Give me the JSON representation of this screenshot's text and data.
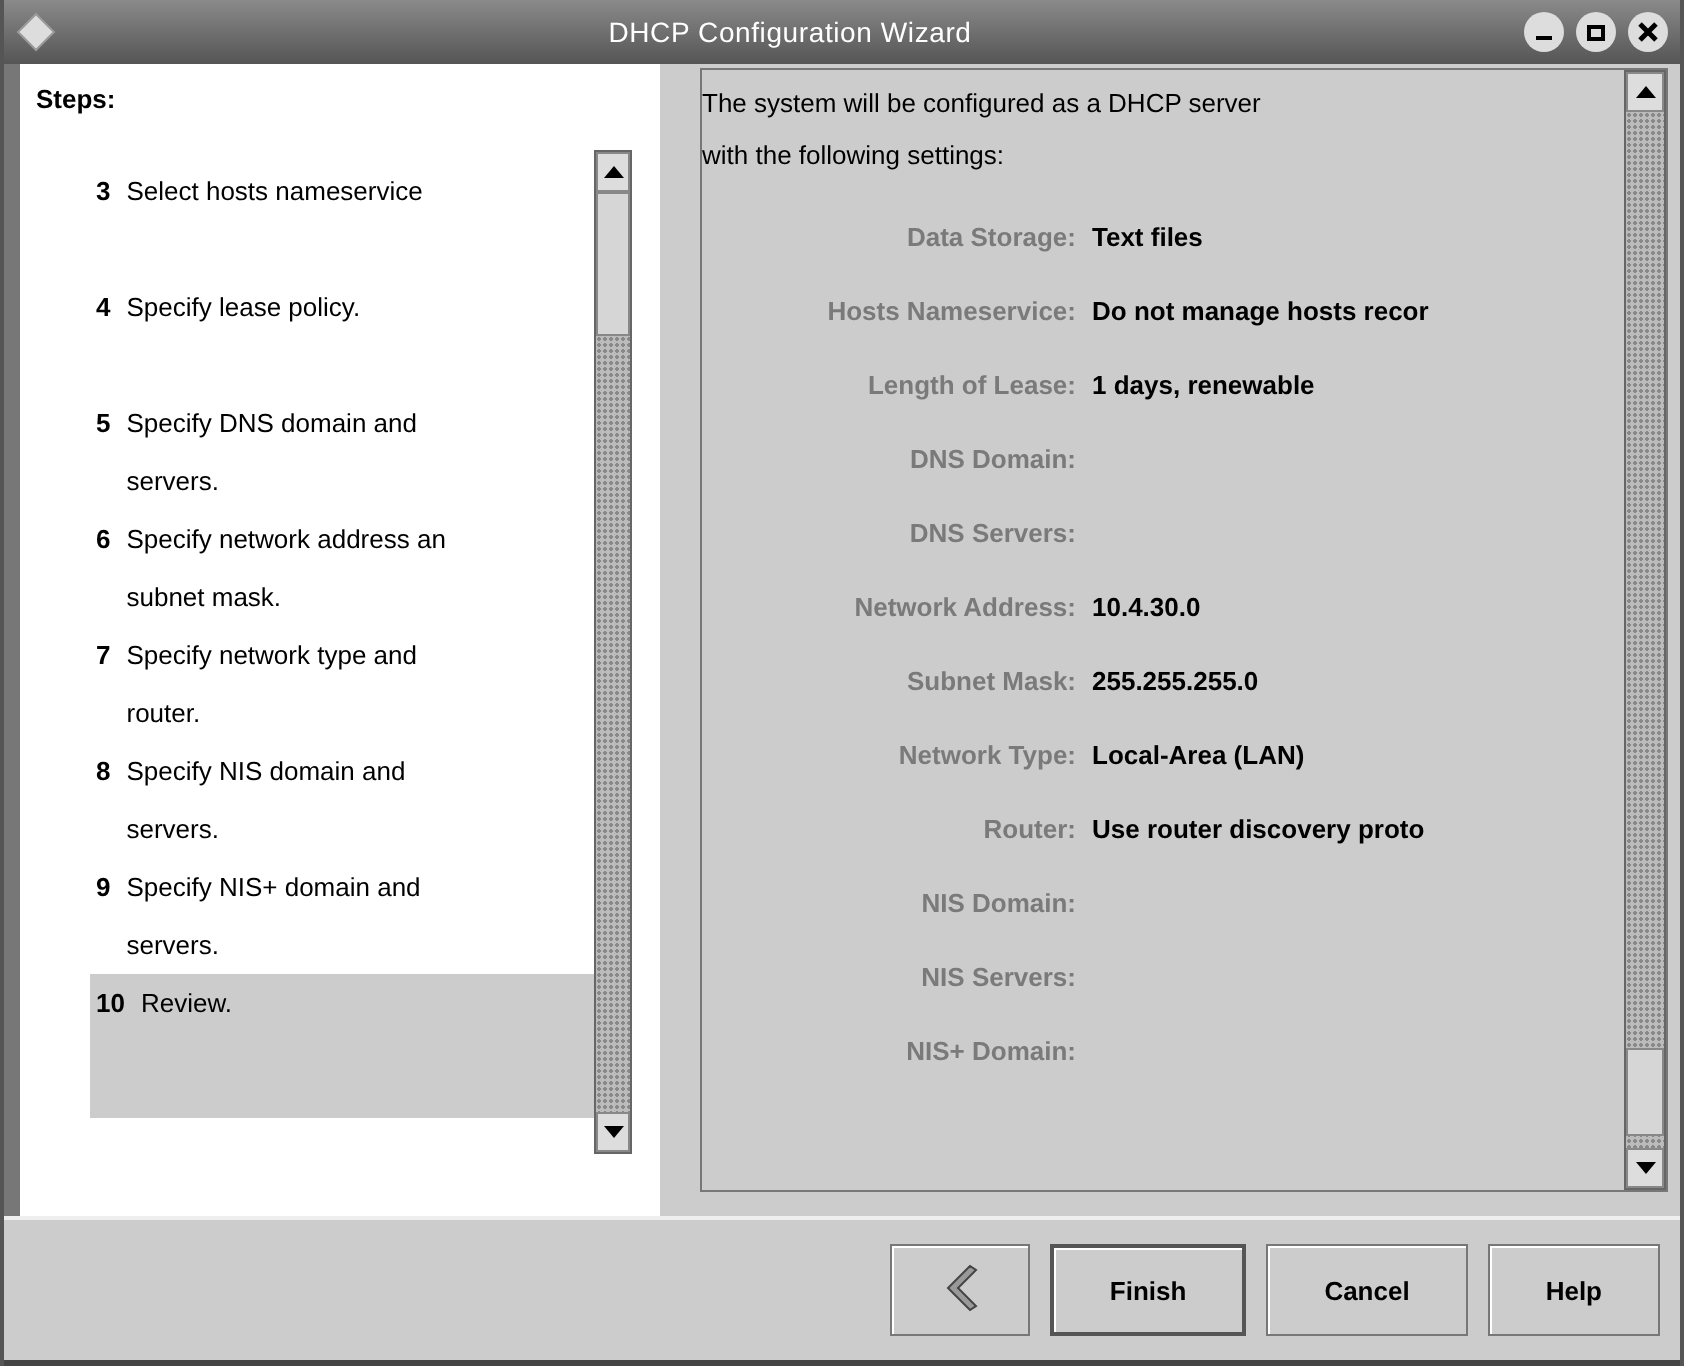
{
  "window": {
    "title": "DHCP Configuration Wizard"
  },
  "steps": {
    "heading": "Steps:",
    "items": [
      {
        "number": "3",
        "lines": [
          "Select hosts nameservice"
        ],
        "selected": false
      },
      {
        "number": "4",
        "lines": [
          "Specify lease policy."
        ],
        "selected": false
      },
      {
        "number": "5",
        "lines": [
          "Specify DNS domain and",
          "servers."
        ],
        "selected": false
      },
      {
        "number": "6",
        "lines": [
          "Specify network address an",
          "subnet mask."
        ],
        "selected": false
      },
      {
        "number": "7",
        "lines": [
          "Specify network type and",
          "router."
        ],
        "selected": false
      },
      {
        "number": "8",
        "lines": [
          "Specify NIS domain and",
          "servers."
        ],
        "selected": false
      },
      {
        "number": "9",
        "lines": [
          "Specify NIS+ domain and",
          "servers."
        ],
        "selected": false
      },
      {
        "number": "10",
        "lines": [
          "Review."
        ],
        "selected": true
      }
    ]
  },
  "summary": {
    "intro": [
      "The system will be configured as a DHCP server",
      "with the following settings:"
    ],
    "rows": [
      {
        "label": "Data Storage:",
        "value": "Text files"
      },
      {
        "label": "Hosts Nameservice:",
        "value": "Do not manage hosts recor"
      },
      {
        "label": "Length of Lease:",
        "value": "1 days, renewable"
      },
      {
        "label": "DNS Domain:"
      },
      {
        "label": "DNS Servers:"
      },
      {
        "label": "Network Address:",
        "value": "10.4.30.0"
      },
      {
        "label": "Subnet Mask:",
        "value": "255.255.255.0"
      },
      {
        "label": "Network Type:",
        "value": "Local-Area (LAN)"
      },
      {
        "label": "Router:",
        "value": "Use router discovery proto"
      },
      {
        "label": "NIS Domain:"
      },
      {
        "label": "NIS Servers:"
      },
      {
        "label": "NIS+ Domain:"
      }
    ]
  },
  "buttons": [
    {
      "kind": "back"
    },
    {
      "kind": "text",
      "label": "Finish",
      "default": true
    },
    {
      "kind": "text",
      "label": "Cancel",
      "default": false
    },
    {
      "kind": "text",
      "label": "Help",
      "default": false
    }
  ]
}
